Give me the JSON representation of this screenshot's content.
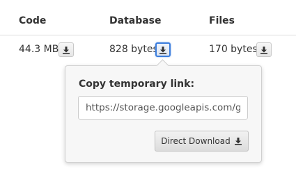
{
  "table": {
    "headers": [
      "Code",
      "Database",
      "Files"
    ],
    "row": {
      "code_size": "44.3 MB",
      "database_size": "828 bytes",
      "files_size": "170 bytes"
    }
  },
  "popover": {
    "title": "Copy temporary link:",
    "link_value": "https://storage.googleapis.com/gc",
    "direct_download_label": "Direct Download"
  },
  "icons": {
    "download": "download-icon"
  },
  "colors": {
    "active_outline": "#3b7ddd"
  }
}
